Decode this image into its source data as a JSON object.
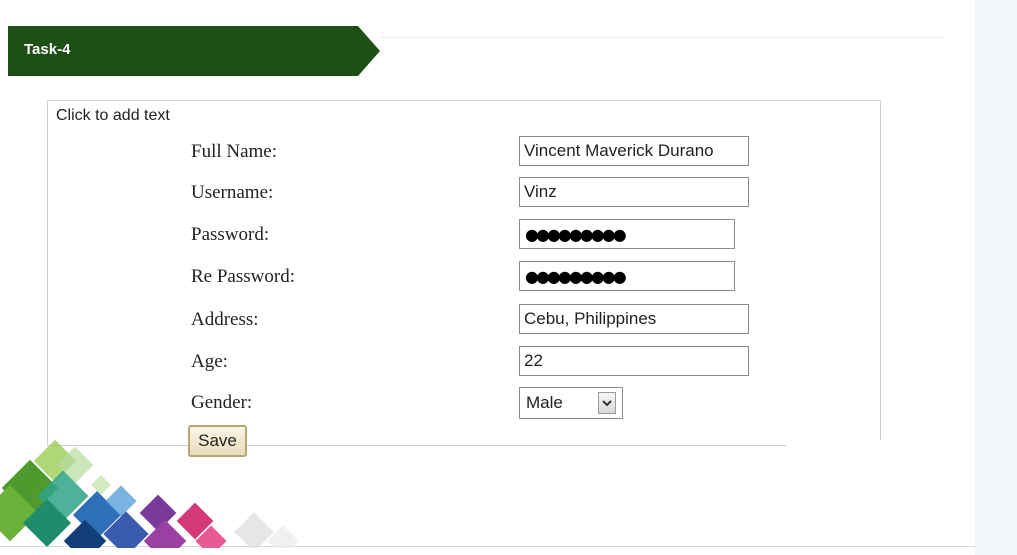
{
  "header": {
    "title": "Task-4"
  },
  "editor": {
    "placeholder_text": "Click to add text"
  },
  "form": {
    "full_name": {
      "label": "Full Name:",
      "value": "Vincent Maverick Durano"
    },
    "username": {
      "label": "Username:",
      "value": "Vinz"
    },
    "password": {
      "label": "Password:",
      "dots": "●●●●●●●●●"
    },
    "re_password": {
      "label": "Re Password:",
      "dots": "●●●●●●●●●"
    },
    "address": {
      "label": "Address:",
      "value": "Cebu, Philippines"
    },
    "age": {
      "label": "Age:",
      "value": "22"
    },
    "gender": {
      "label": "Gender:",
      "value": "Male"
    },
    "save_label": "Save"
  },
  "colors": {
    "banner": "#1e4f15",
    "deco_green": "#6bb23a",
    "deco_teal": "#2fa58a",
    "deco_blue": "#2d6fb8",
    "deco_purple": "#7a3a9a",
    "deco_pink": "#d43a7a"
  }
}
